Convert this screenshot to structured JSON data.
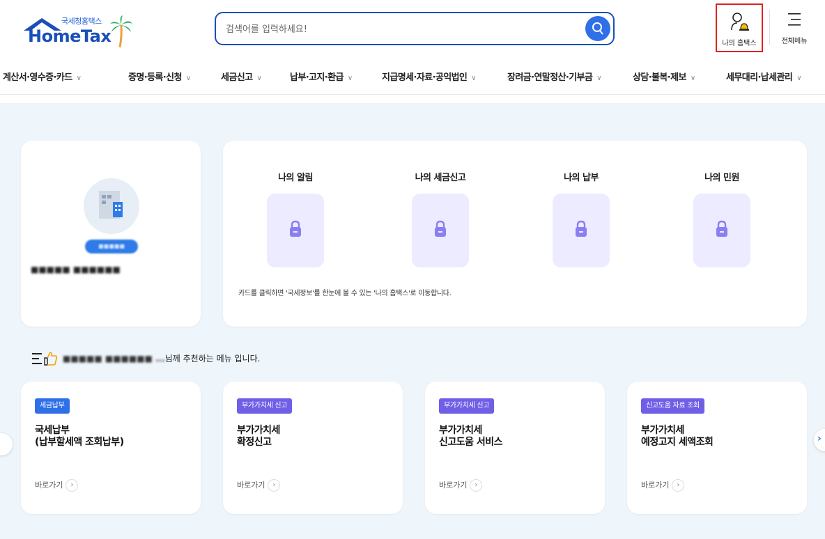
{
  "header": {
    "logo_sub": "국세청홈택스",
    "logo_main": "HomeTax",
    "search_placeholder": "검색어를 입력하세요!",
    "my_hometax_label": "나의 홈택스",
    "all_menu_label": "전체메뉴"
  },
  "nav": {
    "items": [
      {
        "label": "계산서·영수증·카드"
      },
      {
        "label": "증명·등록·신청"
      },
      {
        "label": "세금신고"
      },
      {
        "label": "납부·고지·환급"
      },
      {
        "label": "지급명세·자료·공익법인"
      },
      {
        "label": "장려금·연말정산·기부금"
      },
      {
        "label": "상담·불복·제보"
      },
      {
        "label": "세무대리·납세관리"
      }
    ],
    "chevron": "∨"
  },
  "profile": {
    "badge_label": "■■■■■",
    "name_text": "■■■■■ ■■■■■■"
  },
  "my_cards": {
    "columns": [
      {
        "title": "나의 알림"
      },
      {
        "title": "나의 세금신고"
      },
      {
        "title": "나의 납부"
      },
      {
        "title": "나의 민원"
      }
    ],
    "note": "카드를 클릭하면 '국세정보'를 한눈에 볼 수 있는 '나의 홈택스'로 이동합니다."
  },
  "recommend": {
    "blur_name": "■■■■■ ■■■■■■ ...",
    "suffix": "님께 추천하는 메뉴 입니다.",
    "go_label": "바로가기",
    "cards": [
      {
        "tag": "세금납부",
        "tag_color": "#2f6fe8",
        "name": "국세납부\n(납부할세액 조회납부)"
      },
      {
        "tag": "부가가치세 신고",
        "tag_color": "#6f5fe6",
        "name": "부가가치세\n확정신고"
      },
      {
        "tag": "부가가치세 신고",
        "tag_color": "#6f5fe6",
        "name": "부가가치세\n신고도움 서비스"
      },
      {
        "tag": "신고도움 자료 조회",
        "tag_color": "#6f5fe6",
        "name": "부가가치세\n예정고지 세액조회"
      }
    ]
  },
  "colors": {
    "brand": "#1a4fb8",
    "accent": "#2f6fe8",
    "lock": "#8a7ff0",
    "highlight_border": "#e02020",
    "background": "#eef5fb"
  }
}
